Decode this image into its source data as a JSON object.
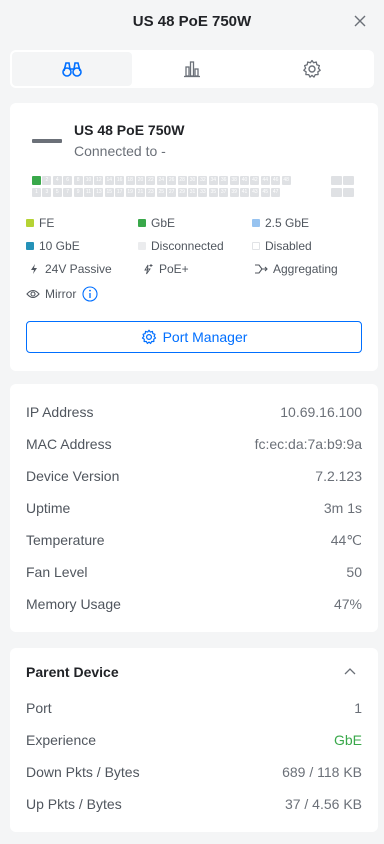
{
  "header": {
    "title": "US 48 PoE 750W",
    "close_icon": "close-icon"
  },
  "tabs": [
    {
      "icon": "binoculars-icon",
      "active": true
    },
    {
      "icon": "bar-chart-icon",
      "active": false
    },
    {
      "icon": "gear-icon",
      "active": false
    }
  ],
  "device": {
    "name": "US 48 PoE 750W",
    "status": "Connected to -",
    "ports_top": [
      "",
      "2",
      "4",
      "6",
      "8",
      "10",
      "12",
      "14",
      "16",
      "18",
      "20",
      "22",
      "24",
      "26",
      "28",
      "30",
      "32",
      "34",
      "36",
      "38",
      "40",
      "42",
      "44",
      "46",
      "48"
    ],
    "ports_bottom": [
      "1",
      "3",
      "5",
      "7",
      "9",
      "11",
      "13",
      "15",
      "17",
      "19",
      "21",
      "23",
      "25",
      "27",
      "29",
      "31",
      "33",
      "35",
      "37",
      "39",
      "41",
      "43",
      "45",
      "47"
    ]
  },
  "legend": {
    "fe": "FE",
    "gbe": "GbE",
    "gbe25": "2.5 GbE",
    "gbe10": "10 GbE",
    "disconnected": "Disconnected",
    "disabled": "Disabled",
    "passive24": "24V Passive",
    "poeplus": "PoE+",
    "aggregating": "Aggregating",
    "mirror": "Mirror"
  },
  "colors": {
    "fe": "#b5d334",
    "gbe": "#39a84a",
    "gbe25": "#97c3f0",
    "gbe10": "#2592b8",
    "disconnected": "#dfe1e4",
    "accent": "#006fff"
  },
  "port_manager_label": "Port Manager",
  "info": {
    "ip_label": "IP Address",
    "ip": "10.69.16.100",
    "mac_label": "MAC Address",
    "mac": "fc:ec:da:7a:b9:9a",
    "ver_label": "Device Version",
    "ver": "7.2.123",
    "uptime_label": "Uptime",
    "uptime": "3m 1s",
    "temp_label": "Temperature",
    "temp": "44℃",
    "fan_label": "Fan Level",
    "fan": "50",
    "mem_label": "Memory Usage",
    "mem": "47%"
  },
  "parent": {
    "title": "Parent Device",
    "port_label": "Port",
    "port": "1",
    "exp_label": "Experience",
    "exp": "GbE",
    "down_label": "Down Pkts / Bytes",
    "down": "689 / 118 KB",
    "up_label": "Up Pkts / Bytes",
    "up": "37 / 4.56 KB"
  }
}
